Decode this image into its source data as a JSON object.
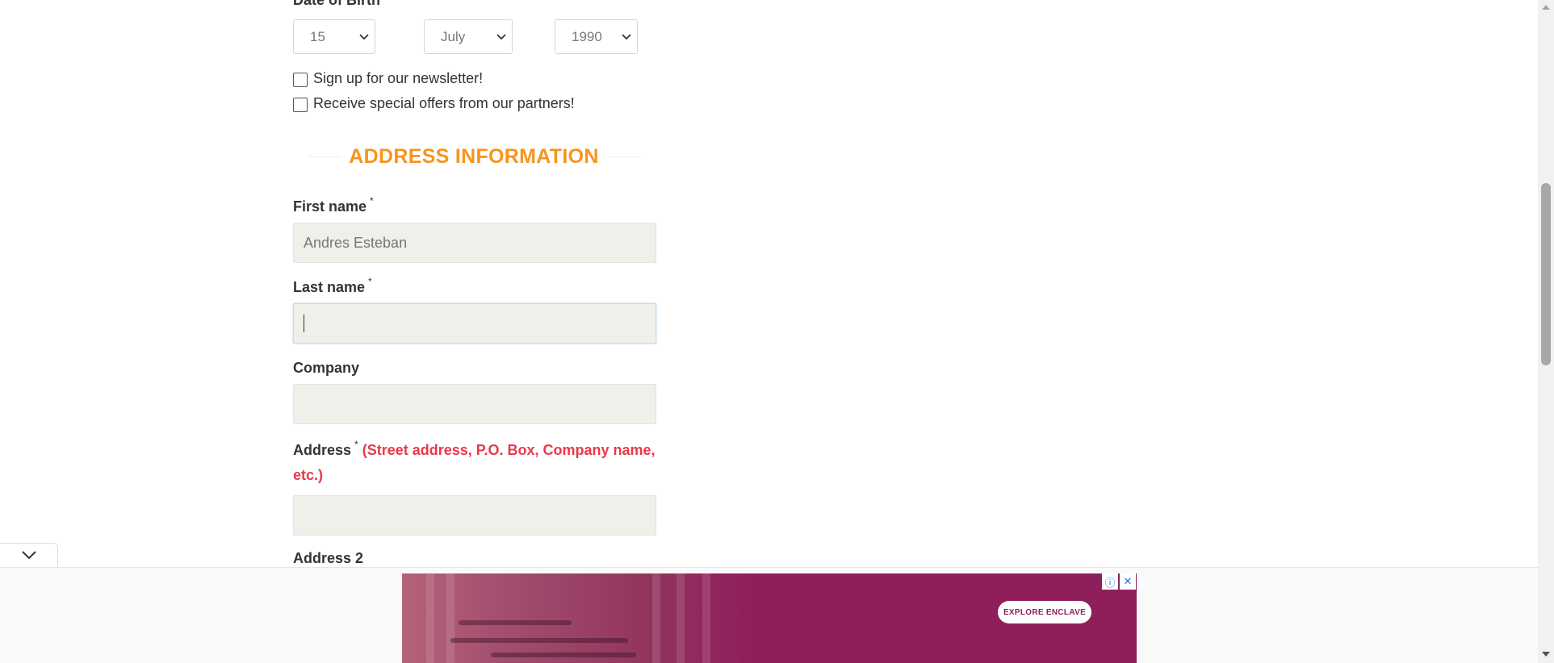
{
  "dob": {
    "label": "Date of Birth",
    "day": "15",
    "month": "July",
    "year": "1990"
  },
  "checkboxes": {
    "newsletter": "Sign up for our newsletter!",
    "offers": "Receive special offers from our partners!"
  },
  "section_title": "ADDRESS INFORMATION",
  "fields": {
    "first_name_label": "First name",
    "first_name_value": "Andres Esteban",
    "last_name_label": "Last name",
    "company_label": "Company",
    "address_label": "Address",
    "address_hint_line1": "(Street address, P.O. Box, Company name,",
    "address_hint_line2": "etc.)",
    "address2_label": "Address 2",
    "required_marker": "*"
  },
  "ad": {
    "cta": "EXPLORE ENCLAVE",
    "info_icon": "ⓘ",
    "close_icon": "✕"
  },
  "icons": {
    "chevron": "chevron-down-icon"
  },
  "colors": {
    "accent": "#f7941d",
    "hint": "#e8394a",
    "input_bg": "#f0efea",
    "ad_bg": "#8f1f5b"
  }
}
